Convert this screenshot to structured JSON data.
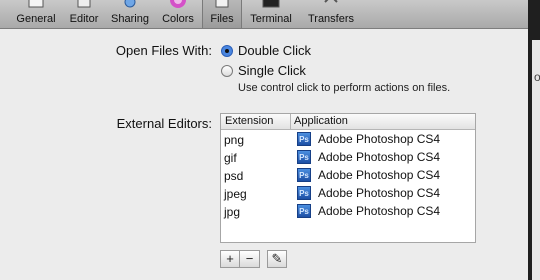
{
  "toolbar": {
    "items": [
      {
        "label": "General"
      },
      {
        "label": "Editor"
      },
      {
        "label": "Sharing"
      },
      {
        "label": "Colors"
      },
      {
        "label": "Files",
        "selected": true
      },
      {
        "label": "Terminal"
      },
      {
        "label": "Transfers"
      }
    ]
  },
  "open_files": {
    "label": "Open Files With:",
    "options": [
      {
        "label": "Double Click",
        "checked": true
      },
      {
        "label": "Single Click",
        "checked": false
      }
    ],
    "hint": "Use control click to perform actions on files."
  },
  "external_editors": {
    "label": "External Editors:",
    "columns": [
      "Extension",
      "Application"
    ],
    "rows": [
      {
        "extension": "png",
        "application": "Adobe Photoshop CS4",
        "icon": "ps-icon"
      },
      {
        "extension": "gif",
        "application": "Adobe Photoshop CS4",
        "icon": "ps-icon"
      },
      {
        "extension": "psd",
        "application": "Adobe Photoshop CS4",
        "icon": "ps-icon"
      },
      {
        "extension": "jpeg",
        "application": "Adobe Photoshop CS4",
        "icon": "ps-icon"
      },
      {
        "extension": "jpg",
        "application": "Adobe Photoshop CS4",
        "icon": "ps-icon"
      }
    ],
    "buttons": {
      "add": "+",
      "remove": "−",
      "edit": "✎"
    },
    "ps_icon_text": "Ps"
  },
  "colors": {
    "accent": "#3b78d8",
    "ps_blue": "#2a64c0"
  },
  "edge_text": "o"
}
